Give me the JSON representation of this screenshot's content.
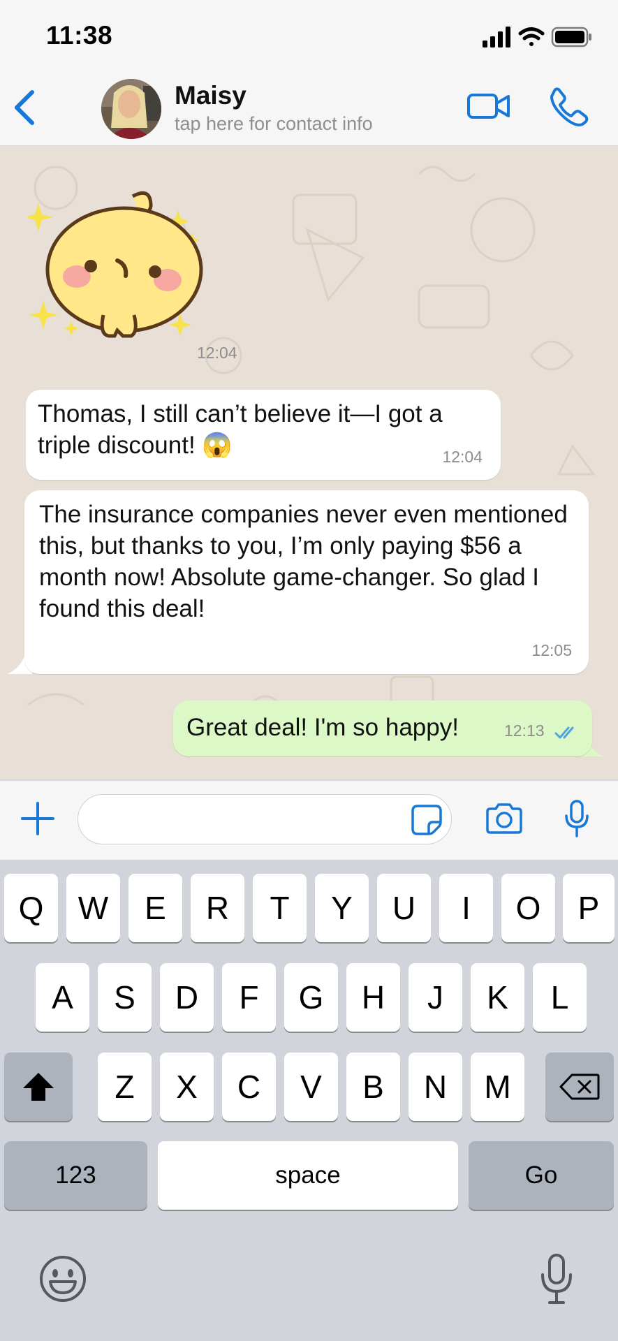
{
  "status_bar": {
    "time": "11:38"
  },
  "header": {
    "contact_name": "Maisy",
    "contact_subtitle": "tap here for contact info",
    "accent_color": "#1878d8"
  },
  "messages": [
    {
      "type": "sticker",
      "direction": "incoming",
      "time": "12:04"
    },
    {
      "type": "text",
      "direction": "incoming",
      "text": "Thomas, I still can’t believe it—I got a triple discount! 😱",
      "time": "12:04"
    },
    {
      "type": "text",
      "direction": "incoming",
      "text": "The insurance companies never even mentioned this, but thanks to you, I’m only paying $56 a month now! Absolute game-changer. So glad I found this deal!",
      "time": "12:05"
    },
    {
      "type": "text",
      "direction": "outgoing",
      "text": "Great deal! I'm so happy!",
      "time": "12:13",
      "status": "read"
    }
  ],
  "composer": {
    "value": ""
  },
  "keyboard": {
    "row1": [
      "Q",
      "W",
      "E",
      "R",
      "T",
      "Y",
      "U",
      "I",
      "O",
      "P"
    ],
    "row2": [
      "A",
      "S",
      "D",
      "F",
      "G",
      "H",
      "J",
      "K",
      "L"
    ],
    "row3": [
      "Z",
      "X",
      "C",
      "V",
      "B",
      "N",
      "M"
    ],
    "numbers_label": "123",
    "space_label": "space",
    "go_label": "Go"
  },
  "colors": {
    "chat_background": "#e8e0d6",
    "incoming_bubble": "#ffffff",
    "outgoing_bubble": "#dcf8c6",
    "read_ticks": "#4fa3e0"
  }
}
